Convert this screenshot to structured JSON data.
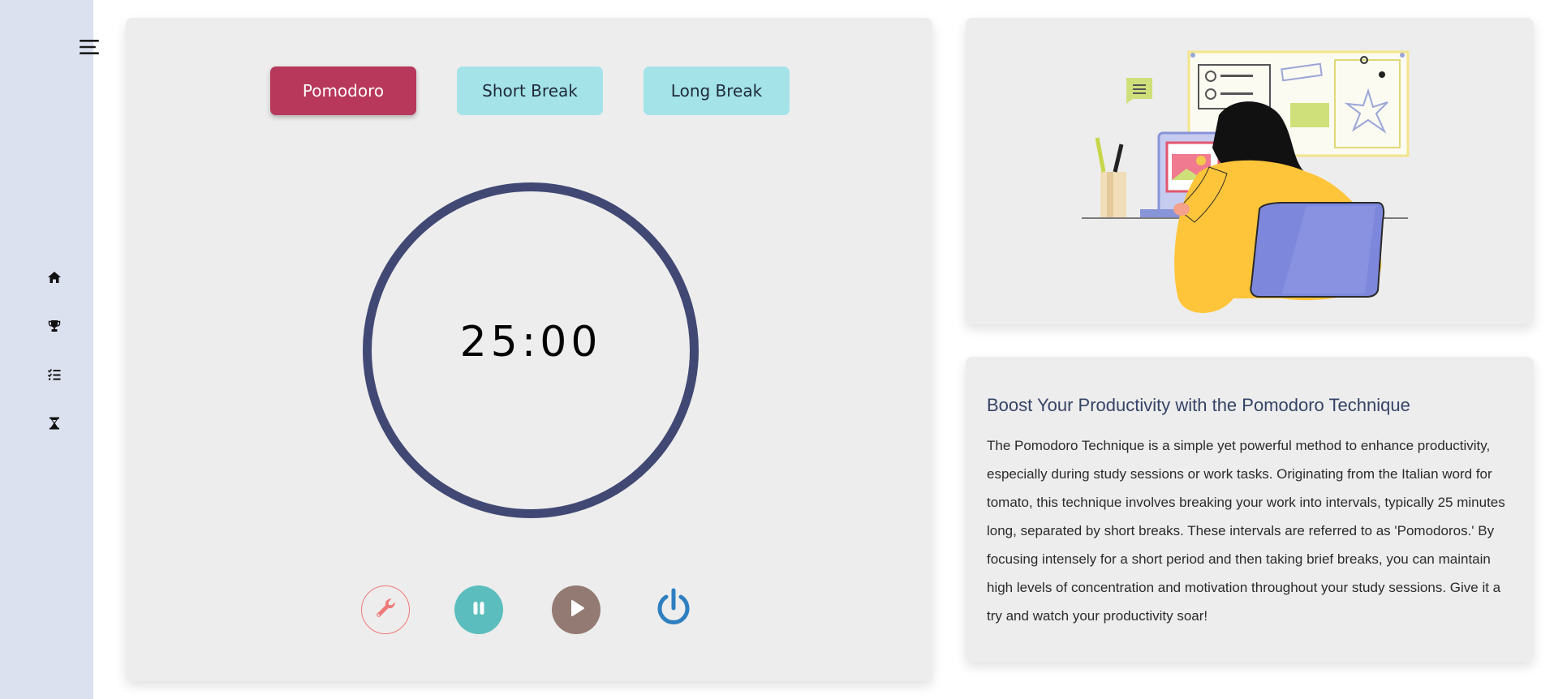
{
  "sidebar": {
    "menu_icon": "hamburger-menu-icon",
    "items": [
      {
        "icon": "home-icon"
      },
      {
        "icon": "trophy-icon"
      },
      {
        "icon": "checklist-icon"
      },
      {
        "icon": "hourglass-icon"
      }
    ]
  },
  "timer": {
    "modes": [
      {
        "label": "Pomodoro",
        "active": true
      },
      {
        "label": "Short Break",
        "active": false
      },
      {
        "label": "Long Break",
        "active": false
      }
    ],
    "time": "25:00",
    "controls": [
      {
        "icon": "wrench-icon"
      },
      {
        "icon": "pause-icon"
      },
      {
        "icon": "play-icon"
      },
      {
        "icon": "power-icon"
      }
    ]
  },
  "info": {
    "title": "Boost Your Productivity with the Pomodoro Technique",
    "body": "The Pomodoro Technique is a simple yet powerful method to enhance productivity, especially during study sessions or work tasks. Originating from the Italian word for tomato, this technique involves breaking your work into intervals, typically 25 minutes long, separated by short breaks. These intervals are referred to as 'Pomodoros.' By focusing intensely for a short period and then taking brief breaks, you can maintain high levels of concentration and motivation throughout your study sessions. Give it a try and watch your productivity soar!"
  },
  "colors": {
    "sidebar_bg": "#dbe1ee",
    "active_mode": "#b8385b",
    "inactive_mode": "#a4e3e8",
    "ring": "#414873",
    "wrench": "#f07a7a",
    "pause": "#5bbdbd",
    "play": "#937a72",
    "power": "#2f7fc0",
    "title": "#354366"
  }
}
